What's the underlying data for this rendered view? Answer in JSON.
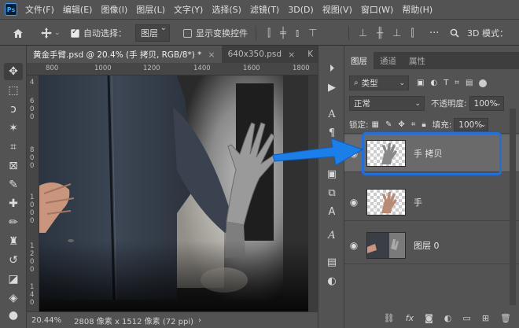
{
  "menu": {
    "logo": "Ps",
    "items": [
      "文件(F)",
      "编辑(E)",
      "图像(I)",
      "图层(L)",
      "文字(Y)",
      "选择(S)",
      "滤镜(T)",
      "3D(D)",
      "视图(V)",
      "窗口(W)",
      "帮助(H)"
    ]
  },
  "options": {
    "home_icon": "home-icon",
    "move_icon": "move-icon",
    "auto_select_label": "自动选择：",
    "auto_select_checked": true,
    "auto_select_target": "图层",
    "show_transform_label": "显示变换控件",
    "show_transform_checked": false,
    "threed_mode_label": "3D 模式："
  },
  "tabs": [
    {
      "label": "黄金手臂.psd @ 20.4% (手 拷贝, RGB/8*) *",
      "active": true
    },
    {
      "label": "640x350.psd",
      "active": false
    },
    {
      "label": "K",
      "active": false
    }
  ],
  "ruler": {
    "top": [
      "800",
      "1000",
      "1200",
      "1400",
      "1600",
      "1800"
    ],
    "left": [
      "4",
      "6",
      "0",
      "0",
      "8",
      "0",
      "0",
      "1",
      "0",
      "0",
      "0",
      "1",
      "2",
      "0",
      "0",
      "1",
      "4",
      "0",
      "0"
    ]
  },
  "status": {
    "zoom": "20.44%",
    "doc_info": "2808 像素 x 1512 像素 (72 ppi)"
  },
  "layers_panel": {
    "tabs": [
      {
        "label": "图层",
        "active": true
      },
      {
        "label": "通道",
        "active": false
      },
      {
        "label": "属性",
        "active": false
      }
    ],
    "filter_label": "类型",
    "blend_mode": "正常",
    "opacity_label": "不透明度:",
    "opacity_value": "100%",
    "lock_label": "锁定:",
    "fill_label": "填充:",
    "fill_value": "100%",
    "layers": [
      {
        "name": "手 拷贝",
        "selected": true,
        "visible": true
      },
      {
        "name": "手",
        "selected": false,
        "visible": true
      },
      {
        "name": "图层 0",
        "selected": false,
        "visible": true
      }
    ]
  },
  "colors": {
    "ui_bg": "#535353",
    "highlight_blue": "#1f6fe0",
    "arrow_blue": "#1a7fe8"
  }
}
